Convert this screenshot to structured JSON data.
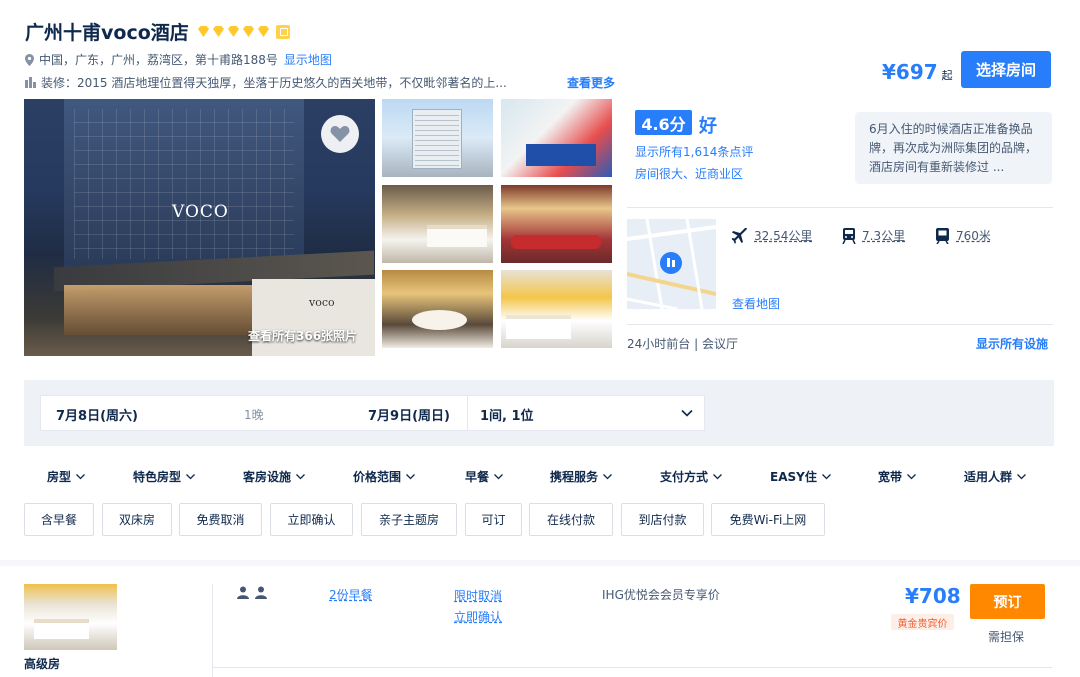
{
  "hotel": {
    "name": "广州十甫voco酒店",
    "star_count": 5,
    "address": "中国，广东，广州，荔湾区，第十甫路188号",
    "show_map": "显示地图",
    "renovation": "装修：2015  酒店地理位置得天独厚，坐落于历史悠久的西关地带，不仅毗邻著名的上...",
    "see_more": "查看更多",
    "price": "¥697",
    "price_suffix": "起",
    "select_room": "选择房间",
    "photo_caption": "查看所有366张照片",
    "photo_sign": "VOCO",
    "photo_wall_sign": "voco"
  },
  "rating": {
    "score": "4.6分",
    "word": "好",
    "reviews_link": "显示所有1,614条点评",
    "tags": "房间很大、近商业区",
    "quote": "6月入住的时候酒店正准备换品牌，再次成为洲际集团的品牌，酒店房间有重新装修过 ..."
  },
  "location": {
    "map_link": "查看地图",
    "airport": "32.54公里",
    "train": "7.3公里",
    "metro": "760米"
  },
  "facilities": {
    "summary": "24小时前台 | 会议厅",
    "show_all": "显示所有设施"
  },
  "search": {
    "checkin": "7月8日(周六)",
    "nights": "1晚",
    "checkout": "7月9日(周日)",
    "rooms_guests": "1间, 1位"
  },
  "filters": [
    "房型",
    "特色房型",
    "客房设施",
    "价格范围",
    "早餐",
    "携程服务",
    "支付方式",
    "EASY住",
    "宽带",
    "适用人群"
  ],
  "chips": [
    "含早餐",
    "双床房",
    "免费取消",
    "立即确认",
    "亲子主题房",
    "可订",
    "在线付款",
    "到店付款",
    "免费Wi-Fi上网"
  ],
  "room": {
    "name": "高级房",
    "breakfast": "2份早餐",
    "cancel": "限时取消",
    "confirm": "立即确认",
    "member": "IHG优悦会会员专享价",
    "price": "¥708",
    "gold_tag": "黄金贵宾价",
    "book": "预订",
    "guarantee": "需担保"
  },
  "colors": {
    "brand_blue": "#287dfa",
    "book_orange": "#ff8800",
    "star_gold": "#ffc82c"
  }
}
